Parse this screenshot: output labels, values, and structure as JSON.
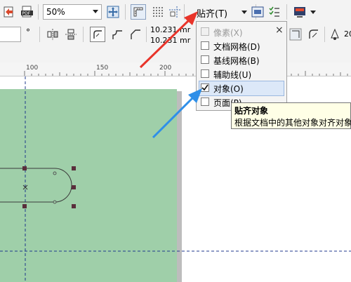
{
  "toolbar1": {
    "zoom": {
      "value": "50%"
    },
    "snap_menu": {
      "label": "贴齐(T)"
    }
  },
  "toolbar2": {
    "degree_symbol": "°",
    "coord_x": "10.231",
    "coord_y": "10.231",
    "unit_x": "mr",
    "unit_y": "mr",
    "right_value": "20"
  },
  "ruler": {
    "labels": [
      "100",
      "150",
      "200"
    ]
  },
  "snap_dropdown": {
    "items": [
      {
        "label": "像素(X)",
        "checked": false,
        "disabled": true
      },
      {
        "label": "文档网格(D)",
        "checked": false,
        "disabled": false
      },
      {
        "label": "基线网格(B)",
        "checked": false,
        "disabled": false
      },
      {
        "label": "辅助线(U)",
        "checked": false,
        "disabled": false
      },
      {
        "label": "对象(O)",
        "checked": true,
        "disabled": false
      },
      {
        "label": "页面(P)",
        "checked": false,
        "disabled": false
      }
    ],
    "close_glyph": "×"
  },
  "tooltip": {
    "title": "贴齐对象",
    "text": "根据文档中的其他对象对齐对象"
  },
  "colors": {
    "page": "#9fcfa9",
    "arrow_red": "#e8342a",
    "arrow_blue": "#2f8fe8",
    "guide": "#1f3a8c",
    "handle": "#5a2e3c"
  }
}
